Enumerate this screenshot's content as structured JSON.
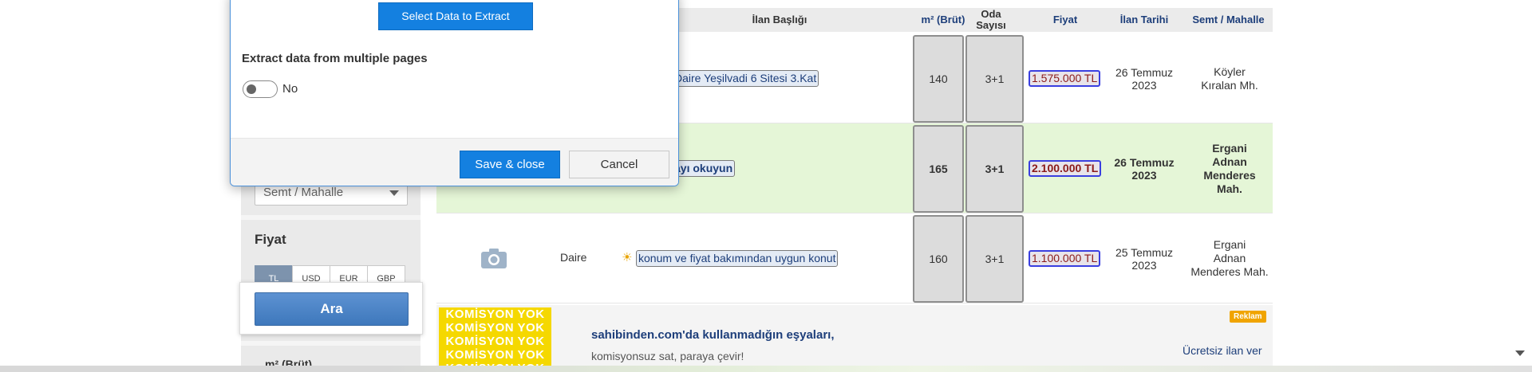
{
  "dialog": {
    "select_data_button": "Select Data to Extract",
    "multi_pages_label": "Extract data from multiple pages",
    "multi_pages_toggle_state": "No",
    "save_close_button": "Save & close",
    "cancel_button": "Cancel"
  },
  "sidebar": {
    "semt_select_value": "Semt / Mahalle",
    "fiyat_title": "Fiyat",
    "currencies": [
      "TL",
      "USD",
      "EUR",
      "GBP"
    ],
    "active_currency": "TL",
    "search_button": "Ara",
    "next_section_label": "m² (Brüt)"
  },
  "table": {
    "headers": {
      "title": "İlan Başlığı",
      "m2": "m² (Brüt)",
      "rooms_line1": "Oda",
      "rooms_line2": "Sayısı",
      "price": "Fiyat",
      "date": "İlan Tarihi",
      "location": "Semt / Mahalle"
    },
    "rows": [
      {
        "title": "Daire Yeşilvadi 6 Sitesi 3.Kat",
        "m2": "140",
        "rooms": "3+1",
        "price": "1.575.000 TL",
        "date_line1": "26 Temmuz",
        "date_line2": "2023",
        "location_line1": "Köyler",
        "location_line2": "Kıralan Mh."
      },
      {
        "title": "ayı okuyun",
        "m2": "165",
        "rooms": "3+1",
        "price": "2.100.000 TL",
        "date_line1": "26 Temmuz",
        "date_line2": "2023",
        "location_lines": [
          "Ergani",
          "Adnan",
          "Menderes",
          "Mah."
        ]
      },
      {
        "type": "Daire",
        "title": "konum ve fiyat bakımından uygun konut",
        "m2": "160",
        "rooms": "3+1",
        "price": "1.100.000 TL",
        "date_line1": "25 Temmuz",
        "date_line2": "2023",
        "location_lines": [
          "Ergani",
          "Adnan",
          "Menderes Mah."
        ]
      }
    ]
  },
  "ad": {
    "banner_text": "KOMİSYON YOK",
    "title": "sahibinden.com'da kullanmadığın eşyaları,",
    "subtitle": "komisyonsuz sat, paraya çevir!",
    "badge": "Reklam",
    "cta_link": "Ücretsiz ilan ver"
  },
  "colors": {
    "accent_blue": "#1480e0",
    "link_blue": "#1d3e7a",
    "highlight_row": "#e5f6d7",
    "price_red": "#8b1a1a",
    "ad_yellow": "#f5d800",
    "badge_orange": "#f0a400"
  }
}
